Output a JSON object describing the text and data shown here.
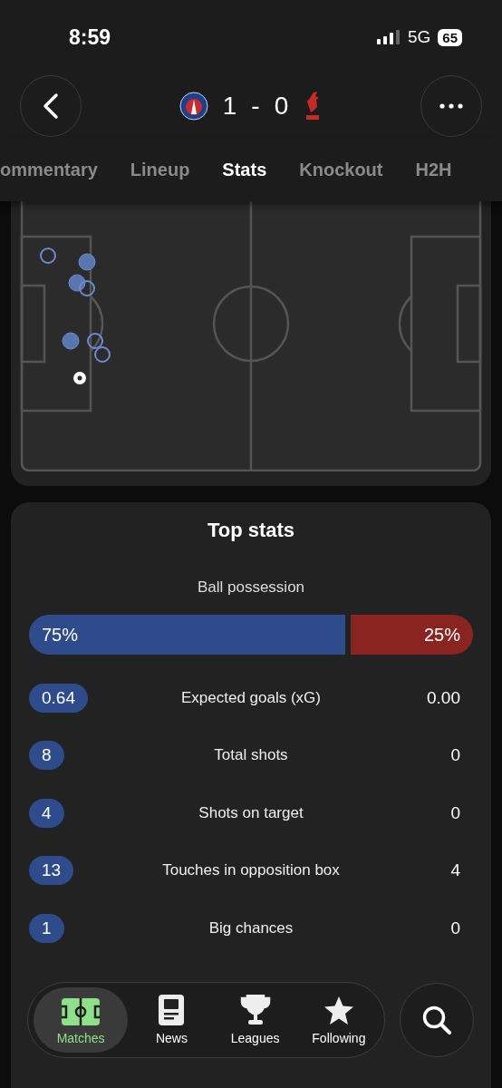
{
  "status_bar": {
    "time": "8:59",
    "network": "5G",
    "battery": "65"
  },
  "header": {
    "home_score": "1",
    "separator": "-",
    "away_score": "0"
  },
  "tabs": [
    {
      "label": "ommentary",
      "selected": false
    },
    {
      "label": "Lineup",
      "selected": false
    },
    {
      "label": "Stats",
      "selected": true
    },
    {
      "label": "Knockout",
      "selected": false
    },
    {
      "label": "H2H",
      "selected": false
    }
  ],
  "shot_map": {
    "shots": [
      {
        "kind": "off_target"
      },
      {
        "kind": "on_target"
      },
      {
        "kind": "on_target"
      },
      {
        "kind": "off_target"
      },
      {
        "kind": "on_target"
      },
      {
        "kind": "off_target"
      },
      {
        "kind": "off_target"
      },
      {
        "kind": "goal"
      }
    ]
  },
  "top_stats": {
    "title": "Top stats",
    "possession": {
      "label": "Ball possession",
      "home": "75%",
      "away": "25%",
      "level": 0.75
    },
    "rows": [
      {
        "label": "Expected goals (xG)",
        "home": "0.64",
        "away": "0.00"
      },
      {
        "label": "Total shots",
        "home": "8",
        "away": "0"
      },
      {
        "label": "Shots on target",
        "home": "4",
        "away": "0"
      },
      {
        "label": "Touches in opposition box",
        "home": "13",
        "away": "4"
      },
      {
        "label": "Big chances",
        "home": "1",
        "away": "0"
      }
    ]
  },
  "bottom_nav": {
    "items": [
      {
        "label": "Matches",
        "selected": true
      },
      {
        "label": "News",
        "selected": false
      },
      {
        "label": "Leagues",
        "selected": false
      },
      {
        "label": "Following",
        "selected": false
      }
    ]
  }
}
